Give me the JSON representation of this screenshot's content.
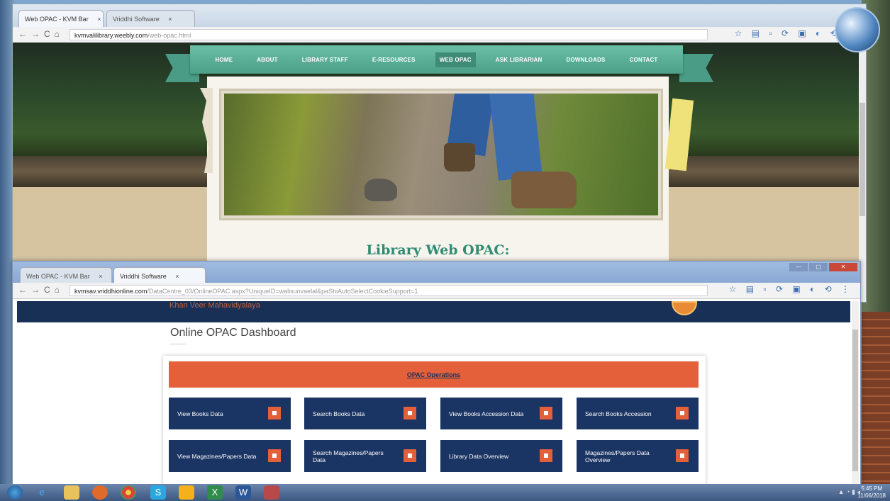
{
  "back_browser": {
    "tabs": [
      {
        "label": "Web OPAC - KVM Bar",
        "close": "×"
      },
      {
        "label": "Vriddhi Software",
        "close": "×"
      }
    ],
    "url_host": "kvmvalilibrary.weebly.com",
    "url_path": "/web-opac.html",
    "site": {
      "nav": [
        "HOME",
        "ABOUT",
        "LIBRARY STAFF",
        "E-RESOURCES",
        "WEB OPAC",
        "ASK LIBRARIAN",
        "DOWNLOADS",
        "CONTACT"
      ],
      "active_nav": "WEB OPAC",
      "page_heading": "Library Web OPAC:"
    }
  },
  "front_browser": {
    "tabs": [
      {
        "label": "Web OPAC - KVM Bar",
        "close": "×"
      },
      {
        "label": "Vriddhi Software",
        "close": "×"
      }
    ],
    "url_host": "kvmsav.vriddhionline.com",
    "url_path": "/DataCentre_03/OnlineOPAC.aspx?UniqueID=walisunvaelal&paShiAutoSelectCookieSupport=1",
    "college_name": "Khan Veer Mahavidyalaya",
    "dashboard_title": "Online OPAC Dashboard",
    "ops_heading": "OPAC Operations",
    "operations": [
      "View Books Data",
      "Search Books Data",
      "View Books Accession Data",
      "Search Books Accession",
      "View Magazines/Papers Data",
      "Search Magazines/Papers Data",
      "Library Data Overview",
      "Magazines/Papers Data Overview"
    ]
  },
  "taskbar": {
    "icons": [
      "start-orb",
      "ie-icon",
      "explorer-icon",
      "media-icon",
      "chrome-icon",
      "skype-icon",
      "app-icon",
      "excel-icon",
      "word-icon",
      "app2-icon"
    ],
    "time": "5:45 PM",
    "date": "11/06/2018"
  },
  "colors": {
    "nav_teal": "#5aaf96",
    "header_navy": "#183056",
    "ops_orange": "#e3603a",
    "tile_navy": "#1a3463",
    "heading_green": "#2f8c72"
  }
}
